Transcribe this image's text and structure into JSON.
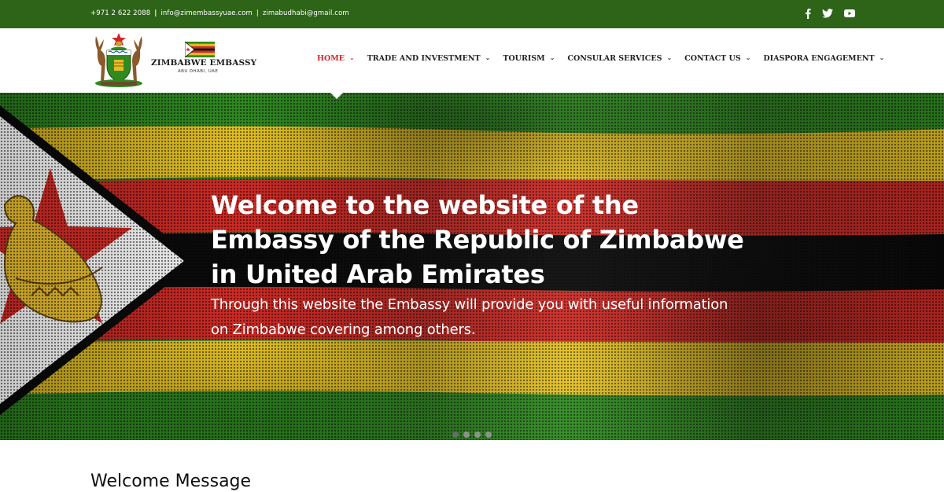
{
  "topbar": {
    "phone": "+971 2 622 2088",
    "email1": "info@zimembassyuae.com",
    "email2": "zimabudhabi@gmail.com",
    "social": [
      {
        "icon": "facebook-icon",
        "label": "f"
      },
      {
        "icon": "twitter-icon",
        "label": "twitter"
      },
      {
        "icon": "youtube-icon",
        "label": "youtube"
      }
    ]
  },
  "logo": {
    "name": "ZIMBABWE EMBASSY",
    "location": "ABU DHABI, UAE"
  },
  "nav": {
    "items": [
      {
        "label": "HOME",
        "active": true
      },
      {
        "label": "TRADE AND INVESTMENT",
        "active": false
      },
      {
        "label": "TOURISM",
        "active": false
      },
      {
        "label": "CONSULAR SERVICES",
        "active": false
      },
      {
        "label": "CONTACT US",
        "active": false
      },
      {
        "label": "DIASPORA ENGAGEMENT",
        "active": false
      }
    ],
    "chevron": "⌄"
  },
  "hero": {
    "title_lines": [
      "Welcome to the website of the",
      "Embassy of the Republic of Zimbabwe",
      "in United Arab Emirates"
    ],
    "text_lines": [
      "Through this website the Embassy will provide you with useful information",
      "on Zimbabwe covering among others."
    ],
    "slides": 4,
    "active_slide": 1
  },
  "section": {
    "heading": "Welcome Message"
  },
  "colors": {
    "topbar_green": "#2d6418",
    "nav_active": "#d3232a",
    "flag_green": "#2f8a1f",
    "flag_yellow": "#e3c021",
    "flag_red": "#cf2a24",
    "flag_black": "#0a0a0a"
  }
}
